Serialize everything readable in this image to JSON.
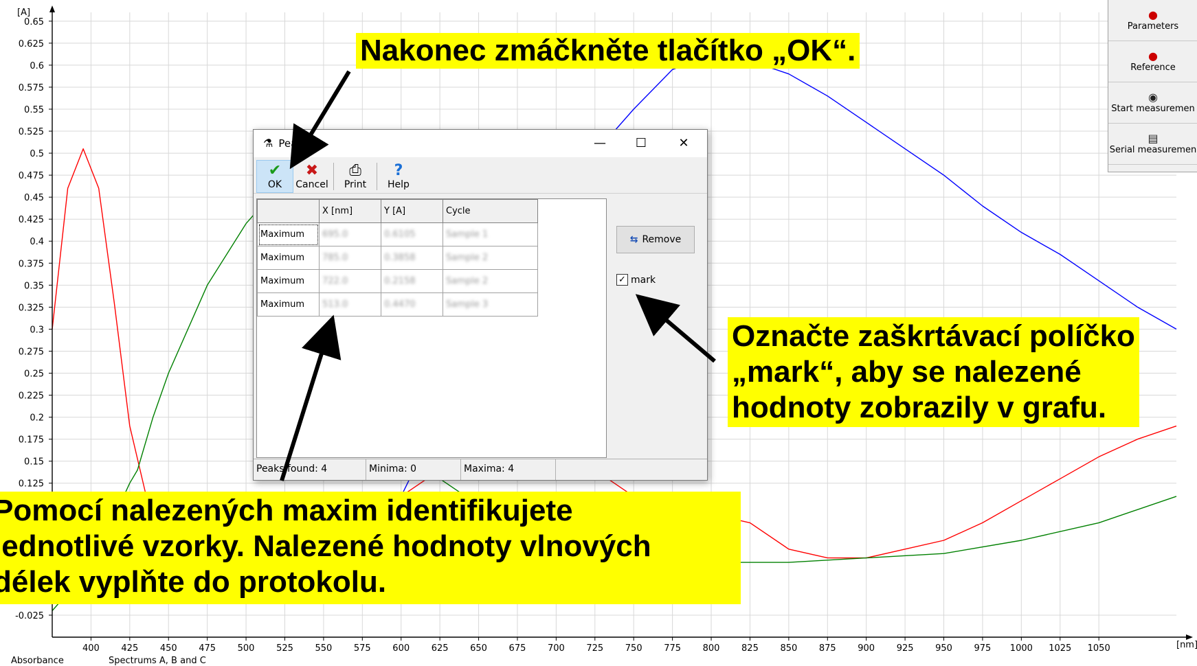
{
  "chart_data": {
    "type": "line",
    "ylabel": "[A]",
    "xlabel": "[nm]",
    "y_ticks": [
      "0.65",
      "0.625",
      "0.6",
      "0.575",
      "0.55",
      "0.525",
      "0.5",
      "0.475",
      "0.45",
      "0.425",
      "0.4",
      "0.375",
      "0.35",
      "0.325",
      "0.3",
      "0.275",
      "0.25",
      "0.225",
      "0.2",
      "0.175",
      "0.15",
      "0.125",
      "-0.025"
    ],
    "x_ticks": [
      "400",
      "425",
      "450",
      "475",
      "500",
      "525",
      "550",
      "575",
      "600",
      "625",
      "650",
      "675",
      "700",
      "725",
      "750",
      "775",
      "800",
      "825",
      "850",
      "875",
      "900",
      "925",
      "950",
      "975",
      "1000",
      "1025",
      "1050"
    ],
    "xlim": [
      375,
      1100
    ],
    "ylim": [
      -0.05,
      0.66
    ],
    "grid": true,
    "series": [
      {
        "color": "#ff0000",
        "x": [
          375,
          385,
          395,
          405,
          415,
          425,
          435,
          445,
          455,
          475,
          500,
          525,
          550,
          575,
          600,
          625,
          650,
          675,
          700,
          725,
          750,
          775,
          800,
          825,
          850,
          875,
          900,
          925,
          950,
          975,
          1000,
          1025,
          1050,
          1075,
          1100
        ],
        "y": [
          0.3,
          0.46,
          0.505,
          0.46,
          0.33,
          0.19,
          0.115,
          0.11,
          0.08,
          0.06,
          0.05,
          0.06,
          0.07,
          0.09,
          0.11,
          0.14,
          0.17,
          0.18,
          0.17,
          0.14,
          0.11,
          0.09,
          0.09,
          0.08,
          0.05,
          0.04,
          0.04,
          0.05,
          0.06,
          0.08,
          0.105,
          0.13,
          0.155,
          0.175,
          0.19
        ]
      },
      {
        "color": "#008000",
        "x": [
          375,
          400,
          425,
          430,
          440,
          450,
          475,
          500,
          525,
          550,
          575,
          600,
          625,
          650,
          700,
          750,
          800,
          850,
          900,
          950,
          1000,
          1050,
          1100
        ],
        "y": [
          -0.02,
          0.03,
          0.125,
          0.14,
          0.2,
          0.25,
          0.35,
          0.42,
          0.47,
          0.42,
          0.3,
          0.2,
          0.13,
          0.1,
          0.06,
          0.04,
          0.035,
          0.035,
          0.04,
          0.045,
          0.06,
          0.08,
          0.11
        ]
      },
      {
        "color": "#0000ff",
        "x": [
          600,
          625,
          650,
          700,
          750,
          775,
          790,
          800,
          825,
          850,
          875,
          900,
          925,
          950,
          975,
          1000,
          1025,
          1050,
          1075,
          1100
        ],
        "y": [
          0.11,
          0.2,
          0.3,
          0.45,
          0.55,
          0.595,
          0.605,
          0.61,
          0.605,
          0.59,
          0.565,
          0.535,
          0.505,
          0.475,
          0.44,
          0.41,
          0.385,
          0.355,
          0.325,
          0.3
        ]
      }
    ]
  },
  "footer": {
    "left": "Absorbance",
    "right": "Spectrums A, B and C"
  },
  "side_toolbar": [
    {
      "label": "Parameters",
      "icon": "parameters-icon"
    },
    {
      "label": "Reference",
      "icon": "reference-icon"
    },
    {
      "label": "Start measuremen",
      "icon": "camera-icon"
    },
    {
      "label": "Serial measuremen",
      "icon": "serial-icon"
    }
  ],
  "dialog": {
    "title": "Peaklist",
    "toolbar": {
      "ok": "OK",
      "cancel": "Cancel",
      "print": "Print",
      "help": "Help"
    },
    "columns": [
      "",
      "X [nm]",
      "Y [A]",
      "Cycle"
    ],
    "rows": [
      {
        "type": "Maximum",
        "x": "695.0",
        "y": "0.6105",
        "cycle": "Sample 1"
      },
      {
        "type": "Maximum",
        "x": "785.0",
        "y": "0.3858",
        "cycle": "Sample 2"
      },
      {
        "type": "Maximum",
        "x": "722.0",
        "y": "0.2158",
        "cycle": "Sample 2"
      },
      {
        "type": "Maximum",
        "x": "513.0",
        "y": "0.4470",
        "cycle": "Sample 3"
      }
    ],
    "remove_label": "Remove",
    "mark_label": "mark",
    "mark_checked": true,
    "status": {
      "peaks": "Peaks found: 4",
      "minima": "Minima: 0",
      "maxima": "Maxima: 4"
    }
  },
  "callouts": {
    "ok": "Nakonec zmáčkněte tlačítko „OK“.",
    "mark_lines": [
      "Označte zaškrtávací políčko",
      "„mark“, aby se nalezené",
      "hodnoty zobrazily v grafu."
    ],
    "maxima_lines": [
      "Pomocí nalezených maxim identifikujete",
      "jednotlivé vzorky. Nalezené hodnoty vlnových",
      "délek vyplňte do protokolu."
    ]
  }
}
